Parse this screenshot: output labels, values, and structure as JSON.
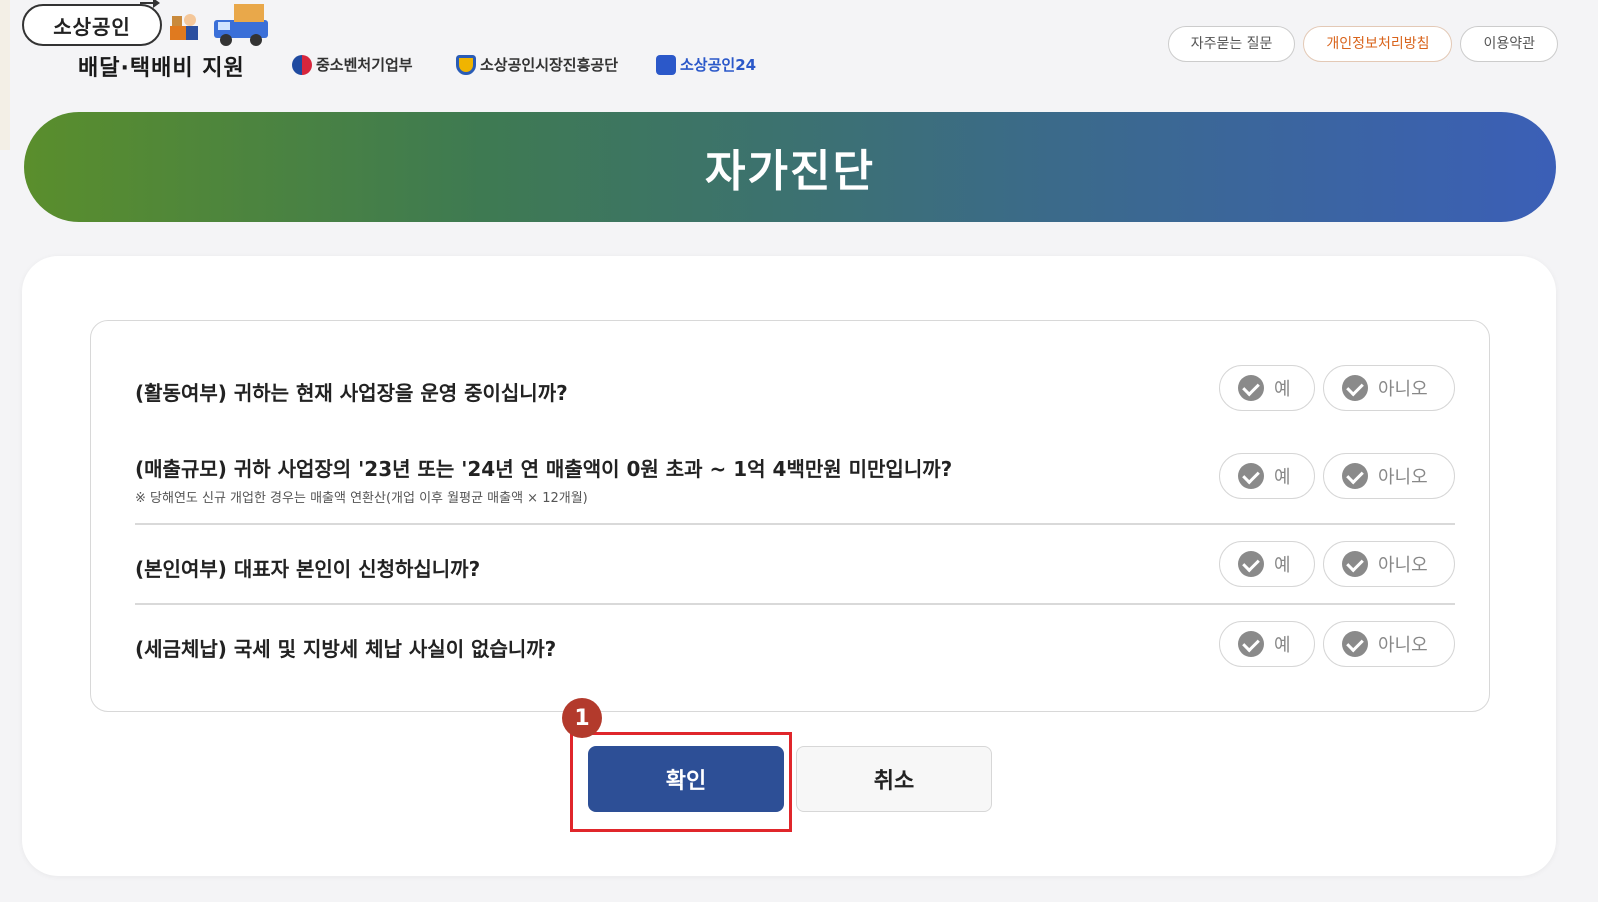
{
  "header": {
    "logo_main": "소상공인",
    "logo_sub": "배달·택배비 지원",
    "agencies": [
      "중소벤처기업부",
      "소상공인시장진흥공단",
      "소상공인24"
    ],
    "links": [
      "자주묻는 질문",
      "개인정보처리방침",
      "이용약관"
    ]
  },
  "banner": {
    "title": "자가진단"
  },
  "questions": [
    {
      "text": "(활동여부) 귀하는 현재 사업장을 운영 중이십니까?",
      "note": "",
      "yes": "예",
      "no": "아니오"
    },
    {
      "text": "(매출규모) 귀하 사업장의 '23년 또는 '24년 연 매출액이 0원 초과 ~ 1억 4백만원 미만입니까?",
      "note": "※ 당해연도 신규 개업한 경우는 매출액 연환산(개업 이후 월평균 매출액 × 12개월)",
      "yes": "예",
      "no": "아니오"
    },
    {
      "text": "(본인여부) 대표자 본인이 신청하십니까?",
      "note": "",
      "yes": "예",
      "no": "아니오"
    },
    {
      "text": "(세금체납) 국세 및 지방세 체납 사실이 없습니까?",
      "note": "",
      "yes": "예",
      "no": "아니오"
    }
  ],
  "step_badge": "1",
  "buttons": {
    "confirm": "확인",
    "cancel": "취소"
  },
  "colors": {
    "confirm_bg": "#2d4f96",
    "highlight_border": "#e0262b",
    "privacy_link": "#d9641c"
  }
}
